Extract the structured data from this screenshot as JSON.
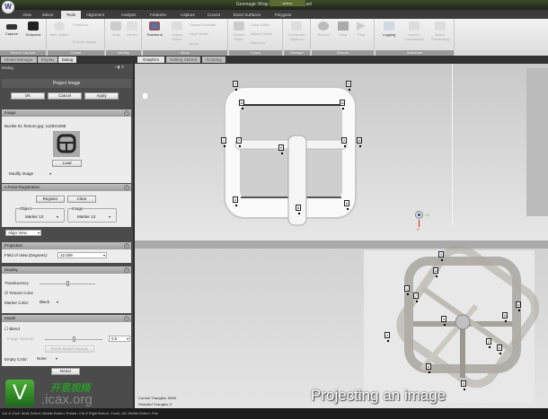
{
  "window": {
    "title": "Geomagic Wrap 2015 -- Buckle 01.wrl",
    "app_logo": "W",
    "context_tab": "Active"
  },
  "ribbon_tabs": [
    "View",
    "Select",
    "Tools",
    "Alignment",
    "Analysis",
    "Features",
    "Capture",
    "Curves",
    "Exact Surfaces",
    "Polygons"
  ],
  "active_tab": "Tools",
  "ribbon_groups": [
    {
      "label": "Screen Capture",
      "buttons": [
        "Capture",
        "Snapshot"
      ]
    },
    {
      "label": "Create",
      "buttons": [
        "New Object"
      ],
      "small": [
        "Primitives",
        "Encode Image"
      ]
    },
    {
      "label": "Identity",
      "buttons": [
        "Units",
        "Inches"
      ]
    },
    {
      "label": "Move",
      "buttons": [
        "Transform",
        "Object Mover"
      ],
      "small": [
        "Rotate/Translate",
        "Align Model",
        "Move"
      ]
    },
    {
      "label": "Colors",
      "buttons": [
        "Texture Maps"
      ],
      "small": [
        "Color Editor",
        "Adjust Colors",
        "Remover"
      ]
    },
    {
      "label": "Manage",
      "buttons": [
        "Coordinate Systems"
      ]
    },
    {
      "label": "Macros",
      "buttons": [
        "Record",
        "Stop",
        "Play"
      ]
    },
    {
      "label": "Automate",
      "buttons": [
        "Logging",
        "Launch Commander",
        "Batch Processing"
      ]
    }
  ],
  "panel_tabs": [
    "Model Manager",
    "Display",
    "Dialog"
  ],
  "viewport_tabs": [
    "Graphics",
    "Getting Started",
    "Scripting"
  ],
  "dialog": {
    "title": "Dialog",
    "name": "Project Image",
    "ok": "OK",
    "cancel": "Cancel",
    "apply": "Apply",
    "image": {
      "header": "Image",
      "filename": "Buckle 01.Texture.jpg: 1128X1088",
      "load": "Load",
      "modify": "Modify Image"
    },
    "registration": {
      "header": "n-Point Registration",
      "register": "Register",
      "clear": "Clear",
      "object_label": "Object",
      "object_value": "Marker 13",
      "image_label": "Image",
      "image_value": "Marker 13",
      "align_view": "Align View"
    },
    "projection": {
      "header": "Projection",
      "fov_label": "Field of View (Degrees):",
      "fov_value": "32.509"
    },
    "display": {
      "header": "Display",
      "translucency_label": "Translucency:",
      "translucency": 0.5,
      "texture_color": "Texture Color",
      "texture_checked": true,
      "marker_color_label": "Marker Color:",
      "marker_color": "Black"
    },
    "model": {
      "header": "Model",
      "blend": "Blend",
      "blend_checked": false,
      "opacity_label": "Image Opacity:",
      "opacity_value": "0.5",
      "reset_opacity": "Reset Model Opacity",
      "empty_color_label": "Empty Color:",
      "empty_color": "None"
    },
    "reset": "Reset"
  },
  "viewport": {
    "markers_top": [
      "3",
      "5",
      "12",
      "11",
      "1",
      "7",
      "9",
      "2",
      "10",
      "4",
      "8",
      "6"
    ],
    "markers_bottom": [
      "3",
      "12",
      "1",
      "7",
      "10",
      "11",
      "9",
      "4",
      "2",
      "6",
      "8",
      "5"
    ],
    "axis_y": "+Y",
    "axis_x": "X",
    "current_triangles": "Current Triangles: 5056",
    "selected_triangles": "Selected Triangles: 0"
  },
  "caption": "Projecting an image",
  "watermark": {
    "letter": "V",
    "text_cn": "开思视频",
    "site": ".icax.org"
  },
  "status_bar": "Ctrl & Click: Multi-Select, Middle Button: Rotate; Ctrl & Right Button: Zoom; Alt: Middle Button: Pan",
  "colors": {
    "ribbon": "#e8e8e8",
    "panel": "#4b4b4b",
    "header": "#a8a8a8",
    "watermark_green": "#2a8a2a"
  }
}
